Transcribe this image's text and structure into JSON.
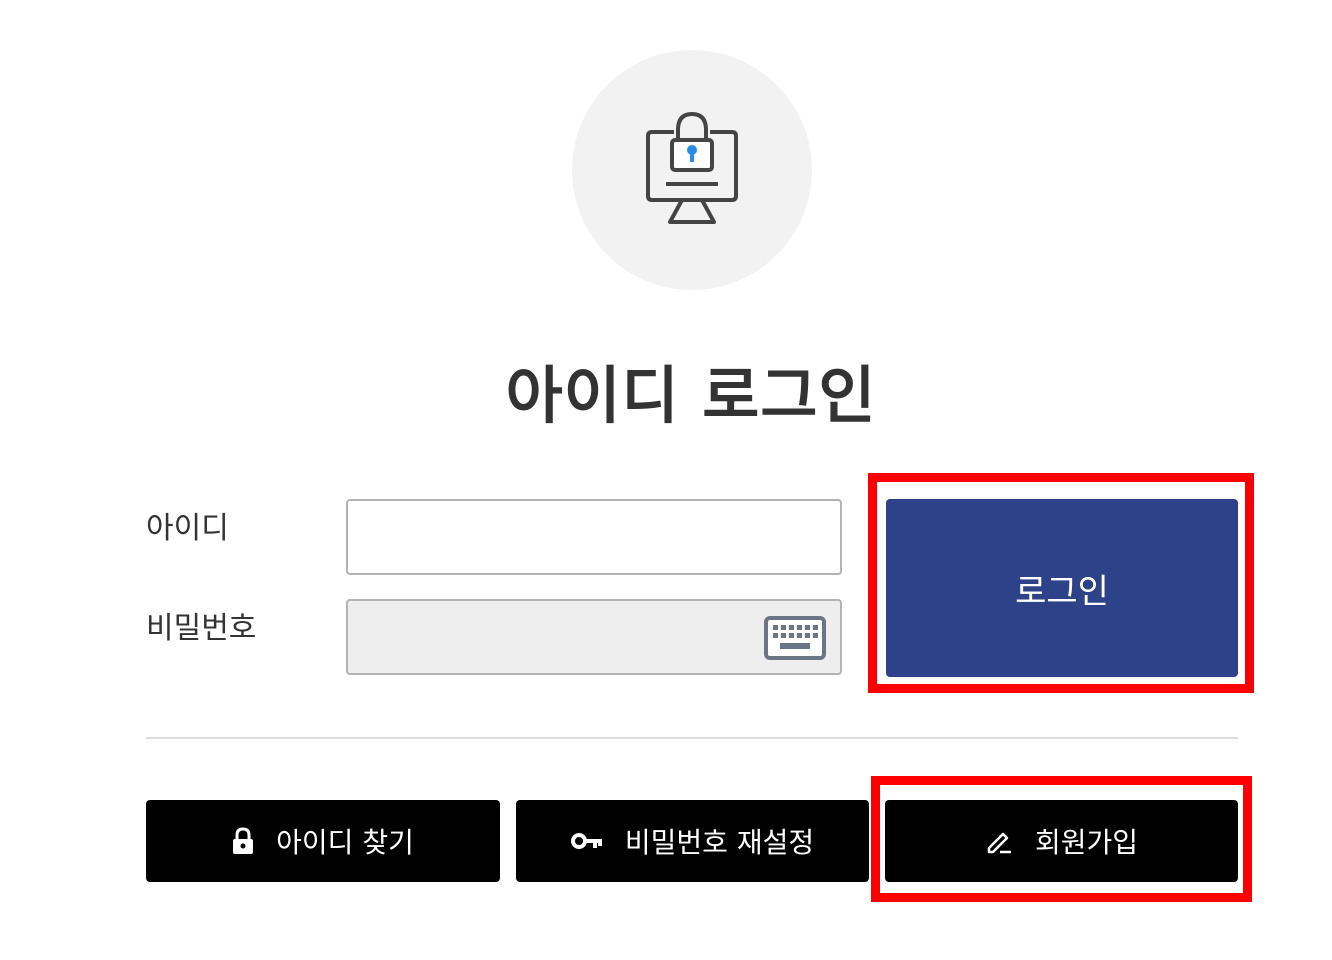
{
  "hero": {
    "icon": "monitor-lock-icon"
  },
  "title": "아이디 로그인",
  "form": {
    "id_label": "아이디",
    "id_value": "",
    "password_label": "비밀번호",
    "password_value": "",
    "keyboard_icon": "keyboard-icon",
    "login_label": "로그인"
  },
  "actions": {
    "find_id": {
      "label": "아이디 찾기",
      "icon": "lock-icon"
    },
    "reset_password": {
      "label": "비밀번호 재설정",
      "icon": "key-icon"
    },
    "signup": {
      "label": "회원가입",
      "icon": "pencil-icon"
    }
  },
  "colors": {
    "login_button": "#2e4289",
    "action_buttons": "#000000",
    "highlight": "#ff0000",
    "hero_circle": "#f2f2f2"
  }
}
